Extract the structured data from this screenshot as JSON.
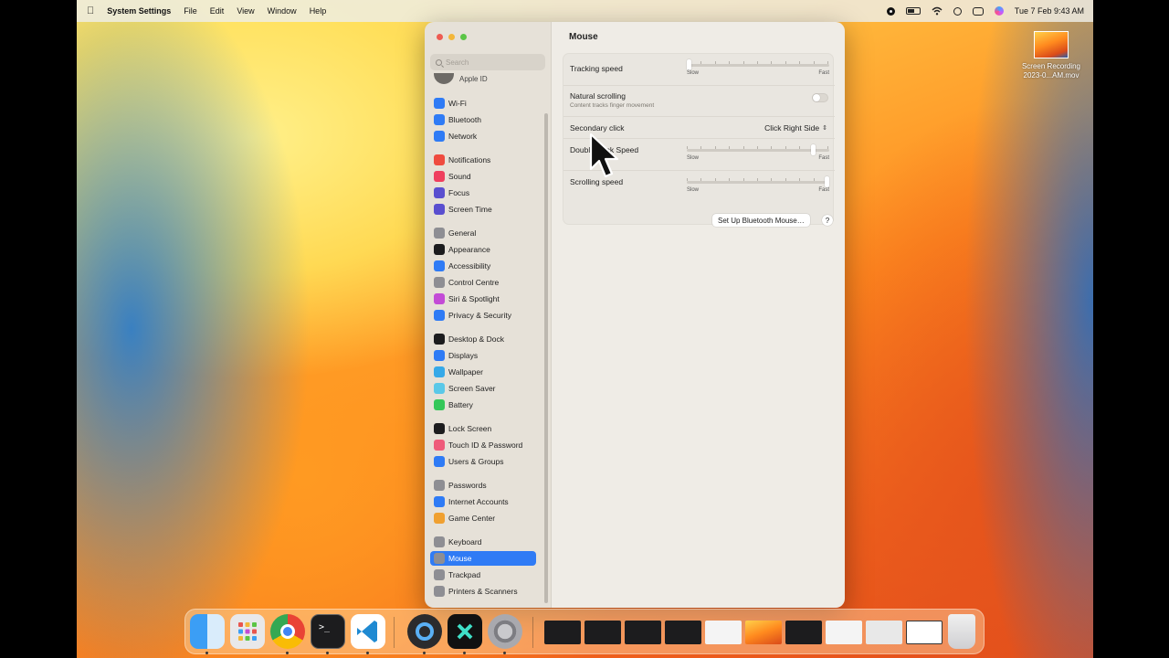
{
  "menubar": {
    "apple_icon": "apple-logo-icon",
    "app_name": "System Settings",
    "menus": [
      "File",
      "Edit",
      "View",
      "Window",
      "Help"
    ],
    "clock": "Tue 7 Feb  9:43 AM"
  },
  "desktop_file": {
    "line1": "Screen Recording",
    "line2": "2023-0...AM.mov"
  },
  "sidebar": {
    "search_placeholder": "Search",
    "apple_id": "Apple ID",
    "items": [
      {
        "label": "Wi-Fi",
        "icon": "wifi-icon",
        "color": "#2f7bf5"
      },
      {
        "label": "Bluetooth",
        "icon": "bluetooth-icon",
        "color": "#2f7bf5"
      },
      {
        "label": "Network",
        "icon": "globe-icon",
        "color": "#2f7bf5"
      },
      {
        "label": "Notifications",
        "icon": "bell-icon",
        "color": "#ef4b3f"
      },
      {
        "label": "Sound",
        "icon": "speaker-icon",
        "color": "#ef3f5e"
      },
      {
        "label": "Focus",
        "icon": "moon-icon",
        "color": "#5a4fcf"
      },
      {
        "label": "Screen Time",
        "icon": "hourglass-icon",
        "color": "#5a4fcf"
      },
      {
        "label": "General",
        "icon": "gear-icon",
        "color": "#8e8e93"
      },
      {
        "label": "Appearance",
        "icon": "appearance-icon",
        "color": "#1c1c1e"
      },
      {
        "label": "Accessibility",
        "icon": "accessibility-icon",
        "color": "#2f7bf5"
      },
      {
        "label": "Control Centre",
        "icon": "switches-icon",
        "color": "#8e8e93"
      },
      {
        "label": "Siri & Spotlight",
        "icon": "siri-icon",
        "color": "#c34bd6"
      },
      {
        "label": "Privacy & Security",
        "icon": "hand-icon",
        "color": "#2f7bf5"
      },
      {
        "label": "Desktop & Dock",
        "icon": "dock-icon",
        "color": "#1c1c1e"
      },
      {
        "label": "Displays",
        "icon": "sun-icon",
        "color": "#2f7bf5"
      },
      {
        "label": "Wallpaper",
        "icon": "flower-icon",
        "color": "#36a9e8"
      },
      {
        "label": "Screen Saver",
        "icon": "screensaver-icon",
        "color": "#5ac8e8"
      },
      {
        "label": "Battery",
        "icon": "battery-icon",
        "color": "#34c759"
      },
      {
        "label": "Lock Screen",
        "icon": "lock-icon",
        "color": "#1c1c1e"
      },
      {
        "label": "Touch ID & Password",
        "icon": "fingerprint-icon",
        "color": "#ef5b7a"
      },
      {
        "label": "Users & Groups",
        "icon": "users-icon",
        "color": "#2f7bf5"
      },
      {
        "label": "Passwords",
        "icon": "key-icon",
        "color": "#8e8e93"
      },
      {
        "label": "Internet Accounts",
        "icon": "at-icon",
        "color": "#2f7bf5"
      },
      {
        "label": "Game Center",
        "icon": "game-center-icon",
        "color": "#f0a030"
      },
      {
        "label": "Keyboard",
        "icon": "keyboard-icon",
        "color": "#8e8e93"
      },
      {
        "label": "Mouse",
        "icon": "mouse-icon",
        "color": "#8e8e93"
      },
      {
        "label": "Trackpad",
        "icon": "trackpad-icon",
        "color": "#8e8e93"
      },
      {
        "label": "Printers & Scanners",
        "icon": "printer-icon",
        "color": "#8e8e93"
      }
    ],
    "selected": "Mouse"
  },
  "content": {
    "title": "Mouse",
    "tracking_speed": {
      "label": "Tracking speed",
      "slow": "Slow",
      "fast": "Fast",
      "value": 0.0
    },
    "natural_scrolling": {
      "label": "Natural scrolling",
      "sub": "Content tracks finger movement",
      "enabled": false
    },
    "secondary_click": {
      "label": "Secondary click",
      "value": "Click Right Side"
    },
    "double_click_speed": {
      "label": "Double-Click Speed",
      "slow": "Slow",
      "fast": "Fast",
      "value": 0.9
    },
    "scrolling_speed": {
      "label": "Scrolling speed",
      "slow": "Slow",
      "fast": "Fast",
      "value": 1.0
    },
    "bluetooth_button": "Set Up Bluetooth Mouse…",
    "help_button": "?"
  },
  "dock": {
    "apps": [
      "finder-icon",
      "launchpad-icon",
      "chrome-icon",
      "terminal-icon",
      "vscode-icon",
      "quicktime-icon",
      "capcut-icon",
      "system-settings-icon"
    ],
    "trash": "trash-icon"
  }
}
